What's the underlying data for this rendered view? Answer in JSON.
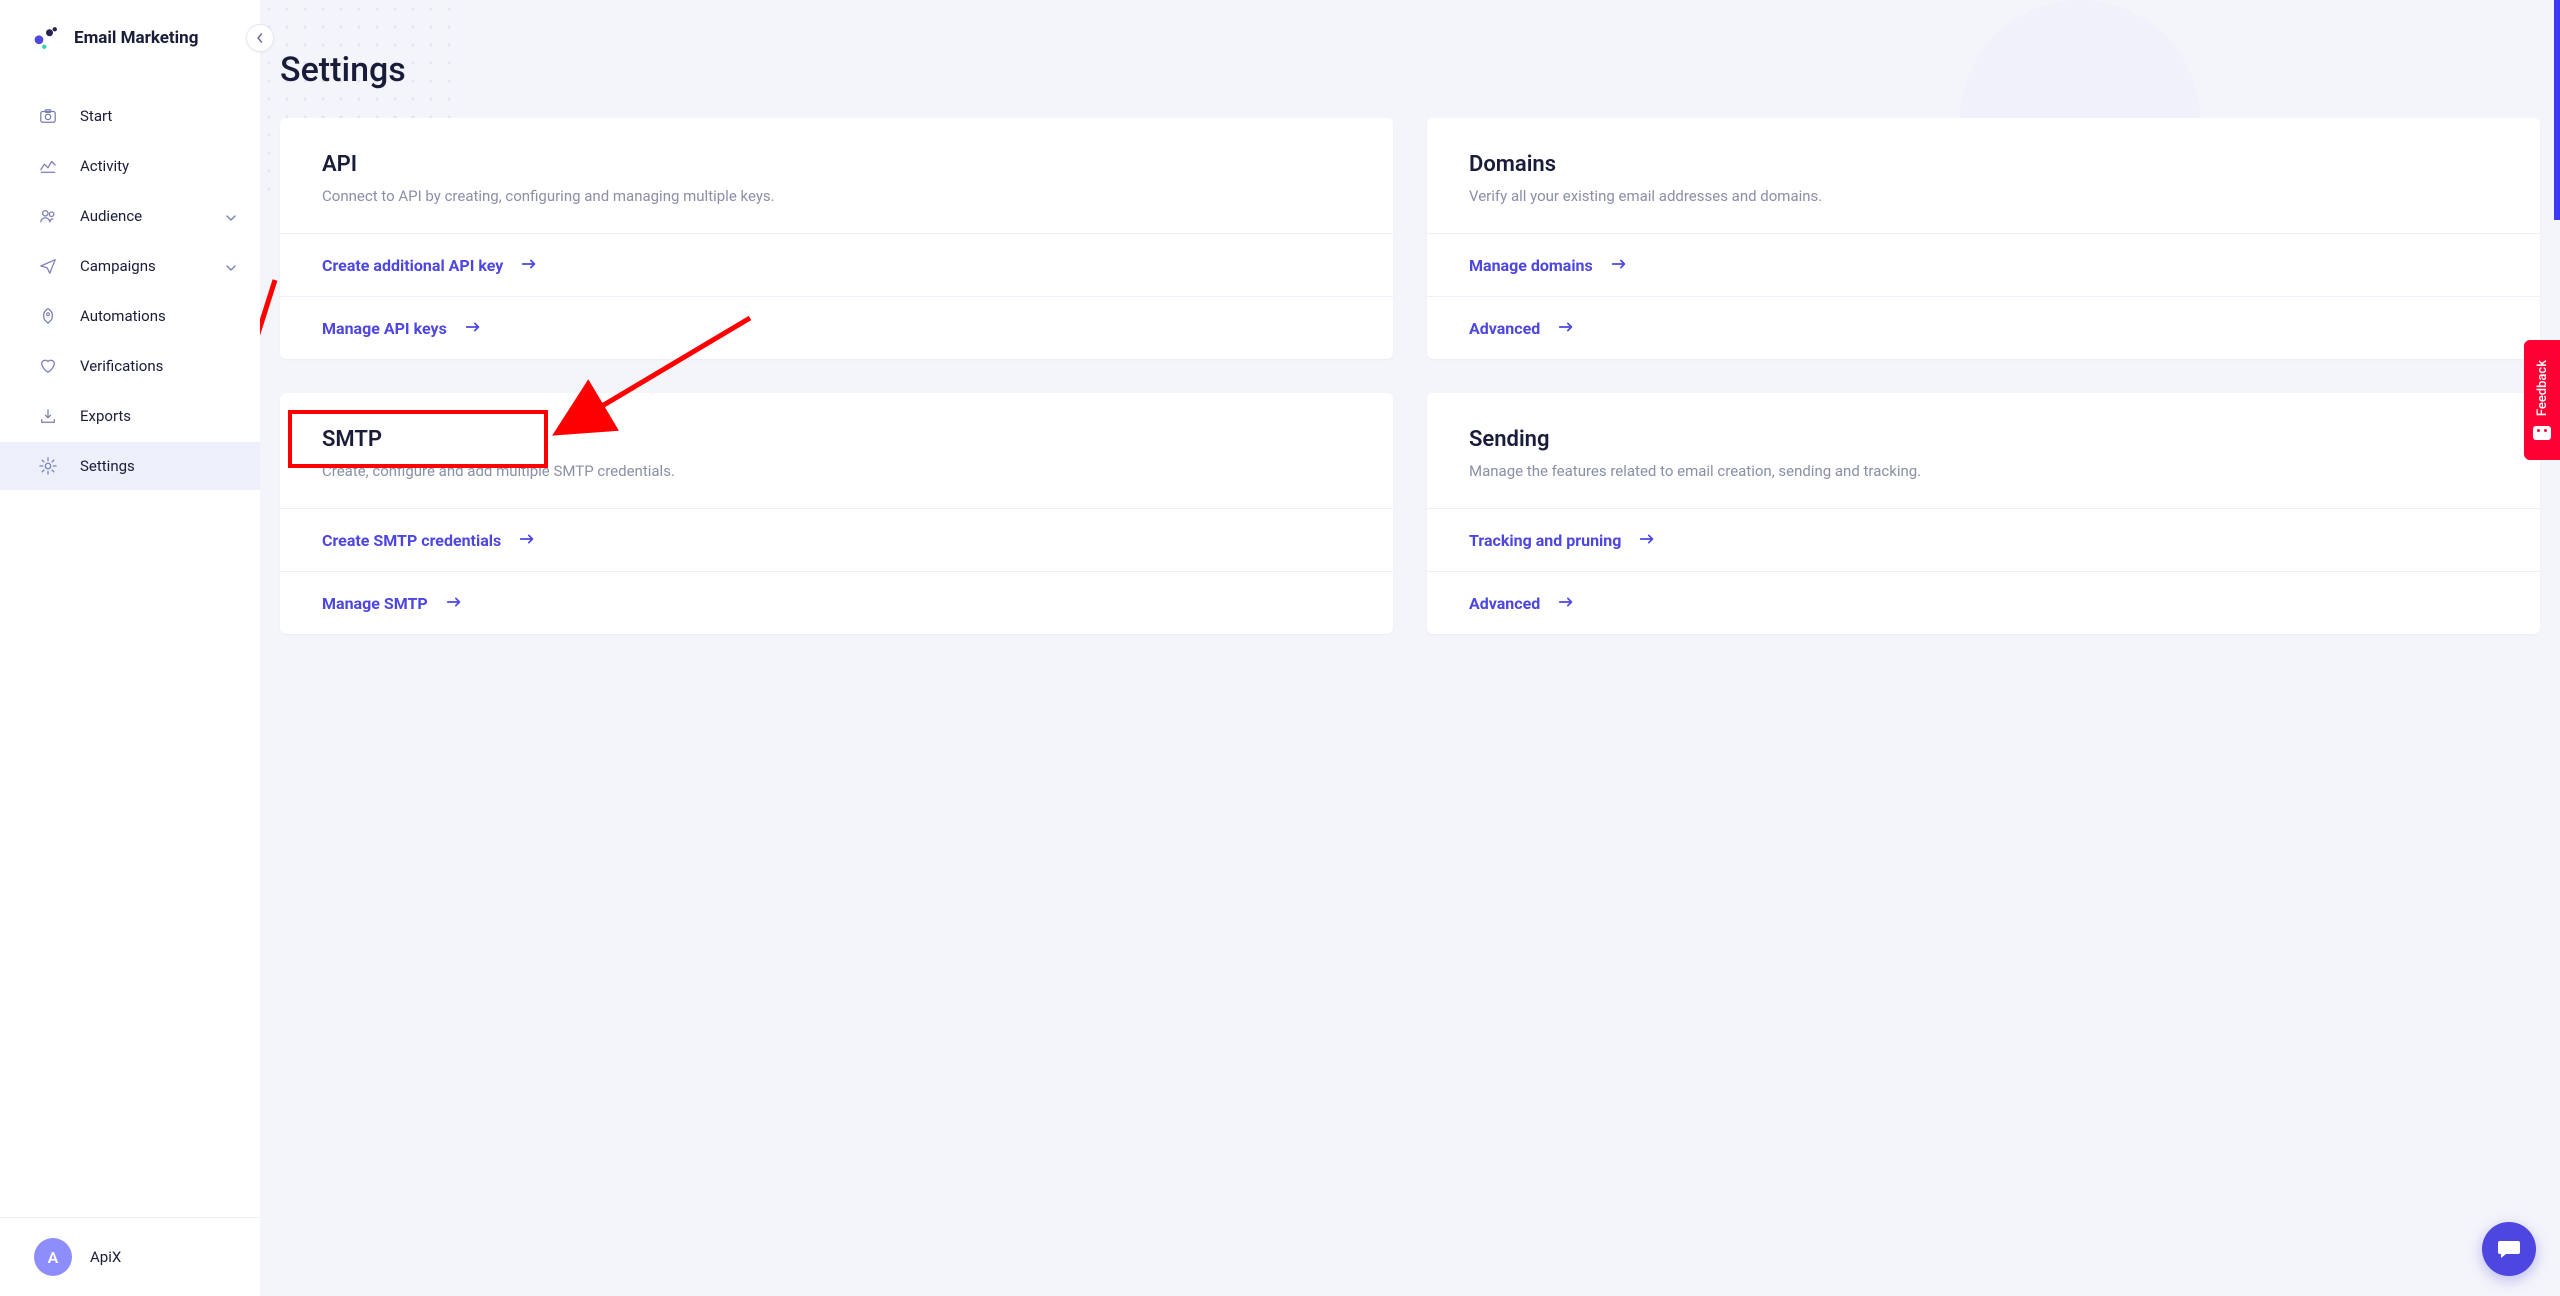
{
  "brand": {
    "title": "Email Marketing"
  },
  "sidebar": {
    "items": [
      {
        "label": "Start"
      },
      {
        "label": "Activity"
      },
      {
        "label": "Audience"
      },
      {
        "label": "Campaigns"
      },
      {
        "label": "Automations"
      },
      {
        "label": "Verifications"
      },
      {
        "label": "Exports"
      },
      {
        "label": "Settings"
      }
    ]
  },
  "user": {
    "initial": "A",
    "name": "ApiX"
  },
  "page": {
    "title": "Settings"
  },
  "cards": {
    "api": {
      "title": "API",
      "desc": "Connect to API by creating, configuring and managing multiple keys.",
      "links": [
        {
          "label": "Create additional API key"
        },
        {
          "label": "Manage API keys"
        }
      ]
    },
    "domains": {
      "title": "Domains",
      "desc": "Verify all your existing email addresses and domains.",
      "links": [
        {
          "label": "Manage domains"
        },
        {
          "label": "Advanced"
        }
      ]
    },
    "smtp": {
      "title": "SMTP",
      "desc": "Create, configure and add multiple SMTP credentials.",
      "links": [
        {
          "label": "Create SMTP credentials"
        },
        {
          "label": "Manage SMTP"
        }
      ]
    },
    "sending": {
      "title": "Sending",
      "desc": "Manage the features related to email creation, sending and tracking.",
      "links": [
        {
          "label": "Tracking and pruning"
        },
        {
          "label": "Advanced"
        }
      ]
    }
  },
  "feedback": {
    "label": "Feedback"
  }
}
